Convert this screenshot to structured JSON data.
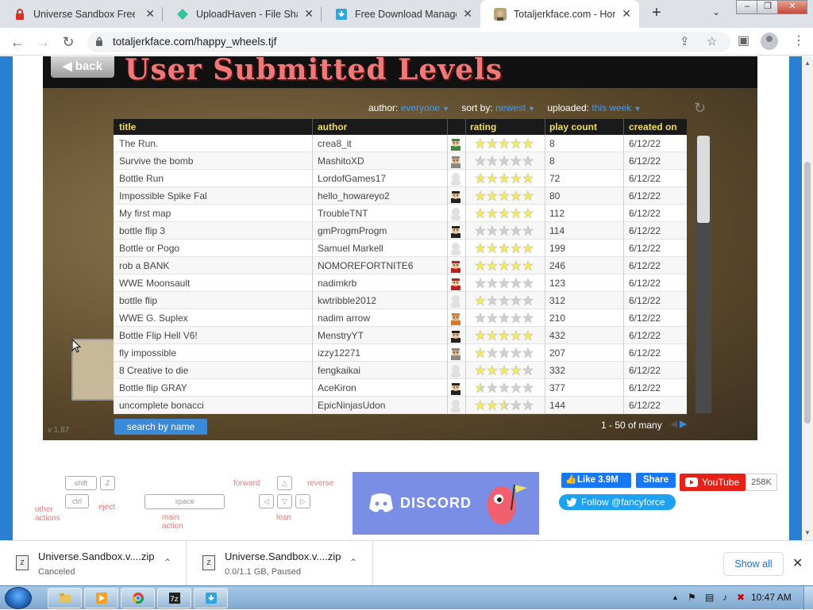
{
  "browser": {
    "tabs": [
      {
        "title": "Universe Sandbox Free D",
        "icon": "lock-red-icon",
        "active": false
      },
      {
        "title": "UploadHaven - File Shari",
        "icon": "uploadhaven-icon",
        "active": false
      },
      {
        "title": "Free Download Manager",
        "icon": "fdm-icon",
        "active": false
      },
      {
        "title": "Totaljerkface.com - Home",
        "icon": "totaljerkface-icon",
        "active": true
      }
    ],
    "url": "totaljerkface.com/happy_wheels.tjf"
  },
  "game": {
    "back_label": "back",
    "title": "User Submitted Levels",
    "filters": {
      "author_label": "author:",
      "author_value": "everyone",
      "sort_label": "sort by:",
      "sort_value": "newest",
      "uploaded_label": "uploaded:",
      "uploaded_value": "this week"
    },
    "columns": {
      "title": "title",
      "author": "author",
      "rating": "rating",
      "play_count": "play count",
      "created_on": "created on"
    },
    "levels": [
      {
        "title": "The Run.",
        "author": "crea8_it",
        "avatar": "male-green",
        "rating": 5,
        "plays": "8",
        "date": "6/12/22"
      },
      {
        "title": "Survive the bomb",
        "author": "MashitoXD",
        "avatar": "old-man",
        "rating": 0,
        "plays": "8",
        "date": "6/12/22"
      },
      {
        "title": "Bottle Run",
        "author": "LordofGames17",
        "avatar": "none",
        "rating": 5,
        "plays": "72",
        "date": "6/12/22"
      },
      {
        "title": "Impossible Spike Fal",
        "author": "hello_howareyo2",
        "avatar": "male-black",
        "rating": 5,
        "plays": "80",
        "date": "6/12/22"
      },
      {
        "title": "My first map",
        "author": "TroubleTNT",
        "avatar": "none",
        "rating": 5,
        "plays": "112",
        "date": "6/12/22"
      },
      {
        "title": "bottle flip 3",
        "author": "gmProgmProgm",
        "avatar": "male-black",
        "rating": 0,
        "plays": "114",
        "date": "6/12/22"
      },
      {
        "title": "Bottle or Pogo",
        "author": "Samuel Markell",
        "avatar": "none",
        "rating": 5,
        "plays": "199",
        "date": "6/12/22"
      },
      {
        "title": "rob a BANK",
        "author": "NOMOREFORTNITE6",
        "avatar": "male-red",
        "rating": 5,
        "plays": "246",
        "date": "6/12/22"
      },
      {
        "title": "WWE  Moonsault",
        "author": "nadimkrb",
        "avatar": "male-red",
        "rating": 0,
        "plays": "123",
        "date": "6/12/22"
      },
      {
        "title": "bottle flip",
        "author": "kwtribble2012",
        "avatar": "none",
        "rating": 1,
        "plays": "312",
        "date": "6/12/22"
      },
      {
        "title": "WWE G. Suplex",
        "author": "nadim arrow",
        "avatar": "kid",
        "rating": 0,
        "plays": "210",
        "date": "6/12/22"
      },
      {
        "title": "Bottle Flip Hell V6!",
        "author": "MenstryYT",
        "avatar": "male-black",
        "rating": 5,
        "plays": "432",
        "date": "6/12/22"
      },
      {
        "title": "fly impossible",
        "author": "izzy12271",
        "avatar": "old-man",
        "rating": 1,
        "plays": "207",
        "date": "6/12/22"
      },
      {
        "title": "8 Creative to die",
        "author": "fengkaikai",
        "avatar": "none",
        "rating": 4,
        "plays": "332",
        "date": "6/12/22"
      },
      {
        "title": "Bottle flip GRAY",
        "author": "AceKiron",
        "avatar": "male-black",
        "rating": 0.5,
        "plays": "377",
        "date": "6/12/22"
      },
      {
        "title": "uncomplete bonacci",
        "author": "EpicNinjasUdon",
        "avatar": "none",
        "rating": 2.5,
        "plays": "144",
        "date": "6/12/22"
      }
    ],
    "search_label": "search by name",
    "pager_text": "1 - 50 of many",
    "version": "v 1.87",
    "controls": {
      "shift": "shift",
      "z": "Z",
      "ctrl": "ctrl",
      "space": "space",
      "other_actions": "other actions",
      "eject": "eject",
      "main_action": "main action",
      "forward": "forward",
      "reverse": "reverse",
      "lean": "lean"
    }
  },
  "social": {
    "discord": "DISCORD",
    "fb_like": "Like 3.9M",
    "fb_share": "Share",
    "youtube": "YouTube",
    "youtube_count": "258K",
    "twitter": "Follow @fancyforce"
  },
  "downloads": [
    {
      "name": "Universe.Sandbox.v....zip",
      "status": "Canceled"
    },
    {
      "name": "Universe.Sandbox.v....zip",
      "status": "0.0/1.1 GB, Paused"
    }
  ],
  "download_bar": {
    "show_all": "Show all"
  },
  "taskbar": {
    "clock": "10:47 AM"
  },
  "colors": {
    "accent_pink": "#f07878",
    "header_yellow": "#f0de52",
    "link_blue": "#4a9ae6",
    "star_gold": "#f3e95a"
  }
}
